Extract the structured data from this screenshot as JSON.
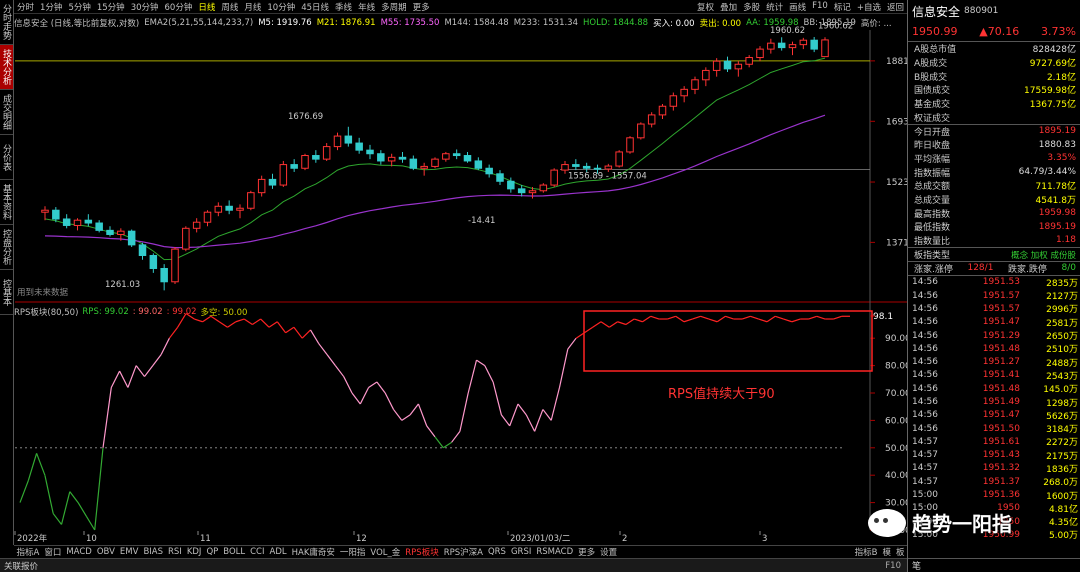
{
  "left_tabs": [
    "分时走势",
    "技术分析",
    "成交明细",
    "分价表",
    "基本资料",
    "控盘分析",
    "控基本"
  ],
  "toolbar": {
    "items": [
      "分时",
      "1分钟",
      "5分钟",
      "15分钟",
      "30分钟",
      "60分钟",
      "日线",
      "周线",
      "月线",
      "10分钟",
      "45日线",
      "季线",
      "年线",
      "多周期",
      "更多"
    ],
    "active": "日线",
    "right": [
      "复权",
      "叠加",
      "多股",
      "统计",
      "画线",
      "F10",
      "标记",
      "+自选",
      "返回"
    ]
  },
  "legend": [
    {
      "text": "信息安全 (日线,等比前复权,对数)",
      "color": "#c0c0c0"
    },
    {
      "text": "EMA2(5,21,55,144,233,7)",
      "color": "#c0c0c0"
    },
    {
      "text": "M5: 1919.76",
      "color": "#ffffff"
    },
    {
      "text": "M21: 1876.91",
      "color": "#ffff00"
    },
    {
      "text": "M55: 1735.50",
      "color": "#ff66ff"
    },
    {
      "text": "M144: 1584.48",
      "color": "#c0c0c0"
    },
    {
      "text": "M233: 1531.34",
      "color": "#c0c0c0"
    },
    {
      "text": "HOLD: 1844.88",
      "color": "#33cc33"
    },
    {
      "text": "买入: 0.00",
      "color": "#ffffff"
    },
    {
      "text": "卖出: 0.00",
      "color": "#ffff00"
    },
    {
      "text": "AA: 1959.98",
      "color": "#33cc33"
    },
    {
      "text": "BB: 1895.19",
      "color": "#c0c0c0"
    },
    {
      "text": "高价: ...",
      "color": "#c0c0c0"
    }
  ],
  "rps_legend": [
    {
      "text": "RPS板块(80,50)",
      "color": "#c0c0c0"
    },
    {
      "text": "RPS: 99.02",
      "color": "#33cc33"
    },
    {
      "text": ": 99.02",
      "color": "#ff6666"
    },
    {
      "text": ": 99.02",
      "color": "#ff3333"
    },
    {
      "text": "多空: 50.00",
      "color": "#cccc00"
    }
  ],
  "price_axis": {
    "labels": [
      "1881",
      "1693",
      "1523",
      "1371"
    ]
  },
  "rps_axis": {
    "labels": [
      "98.1",
      "90.00",
      "80.00",
      "70.00",
      "60.00",
      "50.00",
      "40.00",
      "30.00",
      "20.00"
    ]
  },
  "date_axis": {
    "labels": [
      "2022年",
      "10",
      "11",
      "12",
      "2023/01/03/二",
      "2",
      "3"
    ]
  },
  "annotations": {
    "hi1": "1676.69",
    "hi2": "1960.62",
    "hi3": "1960.62",
    "lo1": "1261.03",
    "lo2": "-14.41",
    "range": "1556.89 - 1557.04",
    "note": "用到未来数据",
    "rps_note": "RPS值持续大于90"
  },
  "bottom_tabs": {
    "items": [
      "指标A",
      "窗口",
      "MACD",
      "OBV",
      "EMV",
      "BIAS",
      "RSI",
      "KDJ",
      "QP",
      "BOLL",
      "CCI",
      "ADL",
      "HAK庸奇安",
      "一阳指",
      "VOL_金",
      "RPS板块",
      "RPS沪深A",
      "QRS",
      "GRSI",
      "RSMACD",
      "更多",
      "设置"
    ],
    "active": "RPS板块",
    "right": [
      "指标B",
      "模",
      "板"
    ]
  },
  "status": {
    "left": "关联报价",
    "right": "F10"
  },
  "quote": {
    "name": "信息安全",
    "code": "880901",
    "price": "1950.99",
    "change": "▲70.16",
    "pct": "3.73%",
    "stats": [
      {
        "k": "A股总市值",
        "v": "828428亿",
        "c": "white"
      },
      {
        "k": "A股成交",
        "v": "9727.69亿",
        "c": "yellow"
      },
      {
        "k": "B股成交",
        "v": "2.18亿",
        "c": "yellow"
      },
      {
        "k": "国债成交",
        "v": "17559.98亿",
        "c": "yellow"
      },
      {
        "k": "基金成交",
        "v": "1367.75亿",
        "c": "yellow"
      },
      {
        "k": "权证成交",
        "v": "",
        "c": "yellow"
      },
      {
        "k": "今日开盘",
        "v": "1895.19",
        "c": "red"
      },
      {
        "k": "昨日收盘",
        "v": "1880.83",
        "c": "white"
      },
      {
        "k": "平均涨幅",
        "v": "3.35%",
        "c": "red"
      },
      {
        "k": "指数振幅",
        "v": "64.79/3.44%",
        "c": "white"
      },
      {
        "k": "总成交额",
        "v": "711.78亿",
        "c": "yellow"
      },
      {
        "k": "总成交量",
        "v": "4541.8万",
        "c": "yellow"
      },
      {
        "k": "最高指数",
        "v": "1959.98",
        "c": "red"
      },
      {
        "k": "最低指数",
        "v": "1895.19",
        "c": "red"
      },
      {
        "k": "指数量比",
        "v": "1.18",
        "c": "red"
      }
    ],
    "type_row": {
      "k": "板指类型",
      "v": "概念 加权 成份股"
    },
    "updown": {
      "k1": "涨家.涨停",
      "v1": "128/1",
      "k2": "跌家.跌停",
      "v2": "8/0"
    },
    "ticks": [
      [
        "14:56",
        "1951.53",
        "2835万"
      ],
      [
        "14:56",
        "1951.57",
        "2127万"
      ],
      [
        "14:56",
        "1951.57",
        "2996万"
      ],
      [
        "14:56",
        "1951.47",
        "2581万"
      ],
      [
        "14:56",
        "1951.29",
        "2650万"
      ],
      [
        "14:56",
        "1951.48",
        "2510万"
      ],
      [
        "14:56",
        "1951.27",
        "2488万"
      ],
      [
        "14:56",
        "1951.41",
        "2543万"
      ],
      [
        "14:56",
        "1951.48",
        "145.0万"
      ],
      [
        "14:56",
        "1951.49",
        "1298万"
      ],
      [
        "14:56",
        "1951.47",
        "5626万"
      ],
      [
        "14:56",
        "1951.50",
        "3184万"
      ],
      [
        "14:57",
        "1951.61",
        "2272万"
      ],
      [
        "14:57",
        "1951.43",
        "2175万"
      ],
      [
        "14:57",
        "1951.32",
        "1836万"
      ],
      [
        "14:57",
        "1951.37",
        "268.0万"
      ],
      [
        "15:00",
        "1951.36",
        "1600万"
      ],
      [
        "15:00",
        "1950",
        "4.81亿"
      ],
      [
        "15:00",
        "1950",
        "4.35亿"
      ],
      [
        "15:00",
        "1950.99",
        "5.00万"
      ]
    ],
    "bottom": "笔"
  },
  "watermark": "趋势一阳指",
  "chart_data": [
    {
      "type": "candlestick",
      "title": "信息安全 (日线,等比前复权,对数)",
      "y_ticks": [
        1881,
        1693,
        1523,
        1371
      ],
      "x_ticks": [
        "2022年",
        "10",
        "11",
        "12",
        "2023/01/03/二",
        "2",
        "3"
      ],
      "candles": [
        [
          1445,
          1460,
          1425,
          1450
        ],
        [
          1450,
          1458,
          1420,
          1428
        ],
        [
          1428,
          1440,
          1405,
          1412
        ],
        [
          1412,
          1430,
          1400,
          1425
        ],
        [
          1425,
          1440,
          1410,
          1418
        ],
        [
          1418,
          1425,
          1395,
          1400
        ],
        [
          1400,
          1410,
          1385,
          1390
        ],
        [
          1390,
          1405,
          1375,
          1398
        ],
        [
          1398,
          1402,
          1360,
          1365
        ],
        [
          1365,
          1370,
          1330,
          1340
        ],
        [
          1340,
          1345,
          1300,
          1310
        ],
        [
          1310,
          1320,
          1261,
          1280
        ],
        [
          1280,
          1360,
          1275,
          1355
        ],
        [
          1355,
          1410,
          1350,
          1405
        ],
        [
          1405,
          1430,
          1395,
          1420
        ],
        [
          1420,
          1450,
          1410,
          1445
        ],
        [
          1445,
          1470,
          1435,
          1460
        ],
        [
          1460,
          1475,
          1440,
          1450
        ],
        [
          1450,
          1465,
          1430,
          1455
        ],
        [
          1455,
          1500,
          1450,
          1495
        ],
        [
          1495,
          1540,
          1485,
          1530
        ],
        [
          1530,
          1545,
          1505,
          1515
        ],
        [
          1515,
          1580,
          1510,
          1570
        ],
        [
          1570,
          1585,
          1550,
          1560
        ],
        [
          1560,
          1600,
          1555,
          1595
        ],
        [
          1595,
          1610,
          1575,
          1585
        ],
        [
          1585,
          1630,
          1580,
          1620
        ],
        [
          1620,
          1660,
          1610,
          1650
        ],
        [
          1650,
          1677,
          1620,
          1630
        ],
        [
          1630,
          1645,
          1600,
          1610
        ],
        [
          1610,
          1625,
          1585,
          1600
        ],
        [
          1600,
          1610,
          1570,
          1580
        ],
        [
          1580,
          1600,
          1565,
          1590
        ],
        [
          1590,
          1605,
          1575,
          1585
        ],
        [
          1585,
          1595,
          1555,
          1560
        ],
        [
          1560,
          1575,
          1540,
          1565
        ],
        [
          1565,
          1590,
          1560,
          1585
        ],
        [
          1585,
          1605,
          1578,
          1600
        ],
        [
          1600,
          1612,
          1585,
          1595
        ],
        [
          1595,
          1605,
          1575,
          1580
        ],
        [
          1580,
          1590,
          1555,
          1560
        ],
        [
          1560,
          1570,
          1535,
          1545
        ],
        [
          1545,
          1555,
          1515,
          1525
        ],
        [
          1525,
          1535,
          1495,
          1505
        ],
        [
          1505,
          1515,
          1485,
          1495
        ],
        [
          1495,
          1510,
          1480,
          1500
        ],
        [
          1500,
          1520,
          1495,
          1515
        ],
        [
          1515,
          1560,
          1510,
          1555
        ],
        [
          1555,
          1580,
          1545,
          1570
        ],
        [
          1570,
          1585,
          1555,
          1565
        ],
        [
          1565,
          1575,
          1550,
          1560
        ],
        [
          1560,
          1570,
          1545,
          1558
        ],
        [
          1558,
          1572,
          1550,
          1566
        ],
        [
          1566,
          1610,
          1562,
          1605
        ],
        [
          1605,
          1650,
          1600,
          1645
        ],
        [
          1645,
          1690,
          1640,
          1685
        ],
        [
          1685,
          1720,
          1675,
          1712
        ],
        [
          1712,
          1745,
          1700,
          1738
        ],
        [
          1738,
          1780,
          1725,
          1770
        ],
        [
          1770,
          1800,
          1750,
          1790
        ],
        [
          1790,
          1830,
          1775,
          1820
        ],
        [
          1820,
          1860,
          1800,
          1850
        ],
        [
          1850,
          1890,
          1830,
          1880
        ],
        [
          1880,
          1895,
          1845,
          1855
        ],
        [
          1855,
          1880,
          1830,
          1870
        ],
        [
          1870,
          1900,
          1860,
          1892
        ],
        [
          1892,
          1930,
          1880,
          1920
        ],
        [
          1920,
          1955,
          1905,
          1940
        ],
        [
          1940,
          1960,
          1915,
          1925
        ],
        [
          1925,
          1945,
          1900,
          1935
        ],
        [
          1935,
          1958,
          1920,
          1950
        ],
        [
          1950,
          1961,
          1910,
          1920
        ],
        [
          1895,
          1960,
          1895,
          1951
        ]
      ]
    },
    {
      "type": "line",
      "title": "RPS板块(80,50)",
      "y_ticks": [
        98.1,
        90,
        80,
        70,
        60,
        50,
        40,
        30,
        20
      ],
      "threshold": 50,
      "series": [
        {
          "name": "RPS",
          "values": [
            30,
            38,
            48,
            40,
            26,
            22,
            34,
            30,
            25,
            20,
            50,
            72,
            78,
            72,
            80,
            76,
            80,
            84,
            90,
            94,
            99,
            97,
            96,
            98,
            96,
            94,
            96,
            97,
            95,
            97,
            94,
            96,
            92,
            94,
            90,
            93,
            88,
            84,
            80,
            76,
            70,
            66,
            72,
            74,
            70,
            64,
            60,
            62,
            66,
            58,
            54,
            50,
            52,
            56,
            70,
            82,
            80,
            74,
            62,
            58,
            66,
            62,
            56,
            64,
            60,
            72,
            86,
            90,
            92,
            94,
            96,
            94,
            96,
            95,
            97,
            96,
            98,
            97,
            97,
            98,
            96,
            97,
            98,
            97,
            96,
            98,
            97,
            97,
            98,
            97,
            96,
            98,
            97,
            96,
            97,
            97,
            98,
            97,
            97,
            98,
            98
          ]
        }
      ]
    }
  ]
}
